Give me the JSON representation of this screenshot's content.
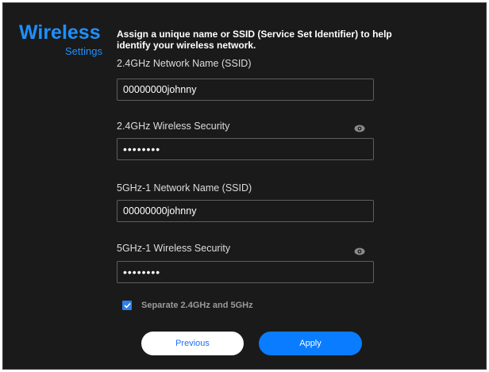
{
  "sidebar": {
    "title": "Wireless",
    "subtitle": "Settings"
  },
  "description": "Assign a unique name or SSID (Service Set Identifier) to help identify your wireless network.",
  "fields": [
    {
      "label": "2.4GHz Network Name (SSID)",
      "value": "00000000johnny",
      "type": "text"
    },
    {
      "label": "2.4GHz Wireless Security",
      "value": "••••••••",
      "type": "password",
      "icon": "eye-icon"
    },
    {
      "label": "5GHz-1 Network Name (SSID)",
      "value": "00000000johnny",
      "type": "text"
    },
    {
      "label": "5GHz-1 Wireless Security",
      "value": "••••••••",
      "type": "password",
      "icon": "eye-icon"
    }
  ],
  "separate_bands": {
    "label": "Separate 2.4GHz and 5GHz",
    "checked": true
  },
  "buttons": {
    "previous": "Previous",
    "apply": "Apply"
  },
  "colors": {
    "accent": "#1e90ff",
    "background": "#1a1a1a",
    "apply_button": "#0a7cff"
  }
}
